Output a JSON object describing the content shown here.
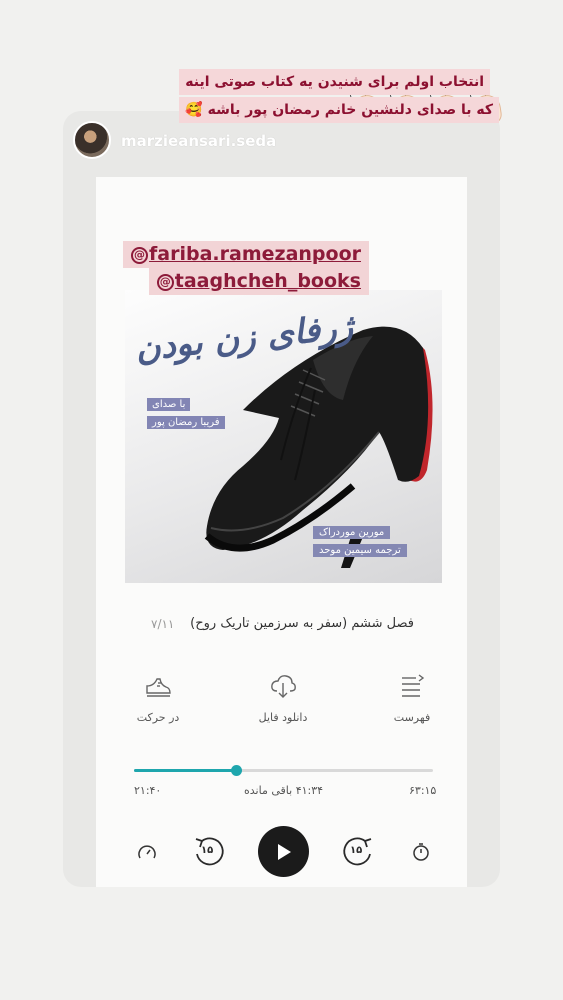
{
  "story": {
    "username": "marzieansari.seda",
    "caption_lines": [
      "انتخاب اولم برای شنیدن یه کتاب صوتی اینه",
      "که با صدای دلنشین خانم رمضان پور باشه 🥰"
    ],
    "mentions": [
      "fariba.ramezanpoor",
      "taaghcheh_books"
    ],
    "mention_symbol": "@"
  },
  "book": {
    "title": "ژرفای زن بودن",
    "narrator_label": "با صدای",
    "narrator": "فریبا رمضان پور",
    "author": "مورین موردراک",
    "translator": "ترجمه سیمین موحد"
  },
  "player": {
    "chapter_title": "فصل ششم (سفر به سرزمین تاریک روح)",
    "chapter_count": "۷/۱۱",
    "actions": [
      {
        "label": "در حرکت",
        "icon": "running-shoe-icon"
      },
      {
        "label": "دانلود فایل",
        "icon": "cloud-download-icon"
      },
      {
        "label": "فهرست",
        "icon": "playlist-icon"
      }
    ],
    "progress": 0.34,
    "elapsed": "۲۱:۴۰",
    "remaining": "۴۱:۳۴ باقی مانده",
    "total": "۶۳:۱۵",
    "skip_back": "۱۵",
    "skip_forward": "۱۵"
  },
  "colors": {
    "accent": "#1ea6ad",
    "caption_text": "#8c1030",
    "caption_bg": "#f5d7d9",
    "cover_label": "#8285b4"
  }
}
